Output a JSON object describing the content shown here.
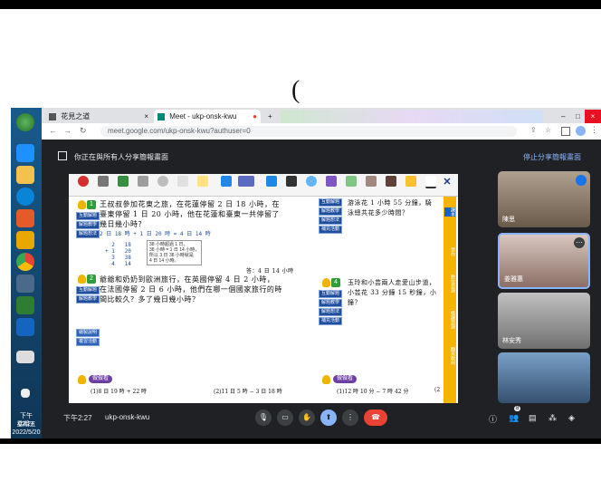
{
  "page": {
    "paren": "("
  },
  "taskbar": {
    "time": "下午 02:27",
    "day": "星期五",
    "date": "2022/5/20"
  },
  "browser": {
    "tabs": [
      {
        "label": "花見之道"
      },
      {
        "label": "Meet - ukp-onsk-kwu"
      }
    ],
    "url": "meet.google.com/ukp-onsk-kwu?authuser=0"
  },
  "banner": {
    "text": "你正在與所有人分享簡報畫面",
    "stop": "停止分享簡報畫面"
  },
  "presentation": {
    "q1": {
      "number": "1",
      "line1": "王叔叔參加花東之旅，在花蓮停留 2 日 18 小時，在",
      "line2": "臺東停留 1 日 20 小時，他在花蓮和臺東一共停留了",
      "line3": "幾日幾小時？",
      "calc_line": "2 日 18 時 + 1 日 20 時 = 4 日 14 時",
      "vertical": "  2   18\n+ 1   20\n  3   38\n  4   14",
      "box": "38 小時超過 1 日，\n38 小時 = 1 日 14 小時，\n所以 3 日 38 小時就是\n4 日 14 小時。",
      "answer": "答：4 日 14 小時"
    },
    "q2": {
      "number": "2",
      "line1": "爺爺和奶奶到歐洲旅行，在英國停留 4 日 2 小時，",
      "line2": "在法國停留 2 日 6 小時，他們在哪一個國家旅行的時",
      "line3": "間比較久？多了幾日幾小時？"
    },
    "q_right": {
      "line1": "游泳花 1 小時 55 分鐘，騎",
      "line2": "泳總共花多少時間？"
    },
    "q3": {
      "number": "4",
      "line1": "玉玲和小芸兩人走愛山步道，",
      "line2": "小芸花 33 分鐘 15 秒鐘，小",
      "line3": "鐘？"
    },
    "buttons": {
      "interactive": "互動解題",
      "solve": "解題教學",
      "idea": "解題想法",
      "game": "補充活動",
      "review": "複習活動",
      "calc": "繪製說明"
    },
    "practice_label": "做做看",
    "practice": [
      "(1)8 日 19 時 + 22 時",
      "(2)11 日 5 時 − 3 日 18 時",
      "(1)12 時 10 分 − 7 時 42 分",
      "(2"
    ],
    "side_strip": [
      "課本",
      "習作",
      "數位資源",
      "備課資源",
      "翻頁教材"
    ]
  },
  "participants": [
    {
      "name": "陳思"
    },
    {
      "name": "姜雅惠"
    },
    {
      "name": "林安秀"
    },
    {
      "name": ""
    }
  ],
  "controls": {
    "time": "下午2:27",
    "meeting_code": "ukp-onsk-kwu",
    "people_count": "8"
  },
  "colors": {
    "meet_bg": "#202124",
    "end_call": "#ea4335",
    "present_active": "#8ab4f8"
  }
}
